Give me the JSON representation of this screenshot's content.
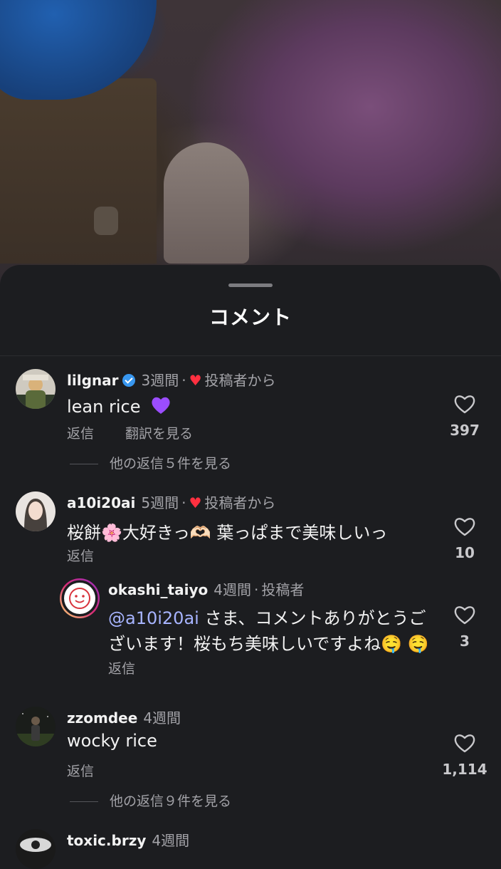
{
  "sheet": {
    "title": "コメント"
  },
  "colors": {
    "accent_like": "#ff3040",
    "mention": "#a7b4ff",
    "verified": "#3897f0"
  },
  "comments": [
    {
      "username": "lilgnar",
      "verified": true,
      "time": "3週間",
      "sep": "·",
      "author_like": "投稿者から",
      "text": "lean rice",
      "emoji": "💜",
      "reply_label": "返信",
      "translate_label": "翻訳を見る",
      "likes": "397",
      "more_replies": "他の返信５件を見る"
    },
    {
      "username": "a10i20ai",
      "time": "5週間",
      "sep": "·",
      "author_like": "投稿者から",
      "text": "桜餅🌸大好きっ🫶🏻 葉っぱまで美味しいっ",
      "reply_label": "返信",
      "likes": "10"
    },
    {
      "username": "okashi_taiyo",
      "time": "4週間",
      "sep": "·",
      "author_badge": "投稿者",
      "mention": "@a10i20ai",
      "text_line1": " さま、コメントありがとうご",
      "text_line2": "ざいます！桜もち美味しいですよね🤤 🤤",
      "reply_label": "返信",
      "likes": "3"
    },
    {
      "username": "zzomdee",
      "time": "4週間",
      "text": "wocky rice",
      "reply_label": "返信",
      "likes": "1,114",
      "more_replies": "他の返信９件を見る"
    },
    {
      "username": "toxic.brzy",
      "time": "4週間"
    }
  ]
}
